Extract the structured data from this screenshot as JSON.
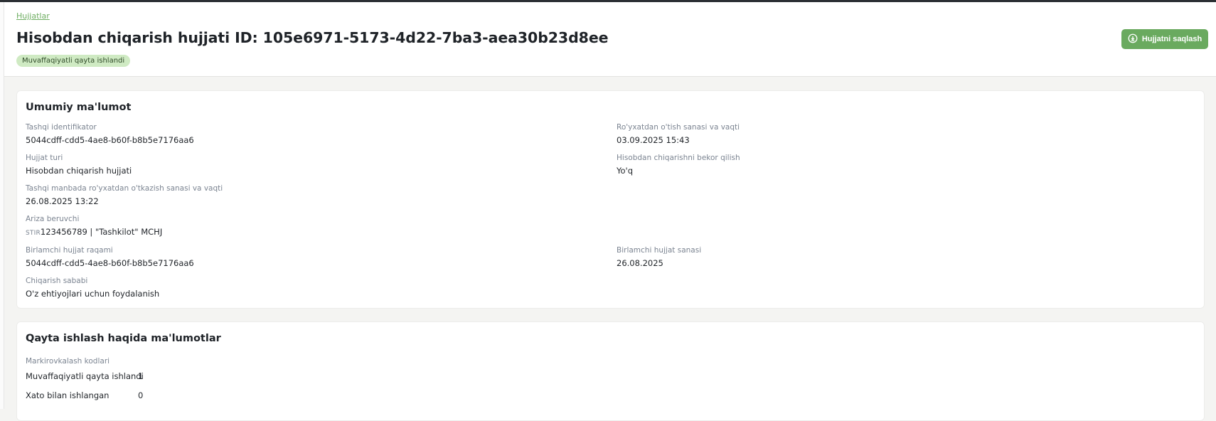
{
  "header": {
    "breadcrumb": "Hujjatlar",
    "title": "Hisobdan chiqarish hujjati ID: 105e6971-5173-4d22-7ba3-aea30b23d8ee",
    "status_badge": "Muvaffaqiyatli qayta ishlandi",
    "save_button": "Hujjatni saqlash",
    "save_icon": "download-icon"
  },
  "general": {
    "title": "Umumiy ma'lumot",
    "external_id": {
      "label": "Tashqi identifikator",
      "value": "5044cdff-cdd5-4ae8-b60f-b8b5e7176aa6"
    },
    "registration_datetime": {
      "label": "Ro'yxatdan o'tish sanasi va vaqti",
      "value": "03.09.2025 15:43"
    },
    "document_type": {
      "label": "Hujjat turi",
      "value": "Hisobdan chiqarish hujjati"
    },
    "cancel_writeoff": {
      "label": "Hisobdan chiqarishni bekor qilish",
      "value": "Yo'q"
    },
    "external_registration": {
      "label": "Tashqi manbada ro'yxatdan o'tkazish sanasi va vaqti",
      "value": "26.08.2025 13:22"
    },
    "applicant": {
      "label": "Ariza beruvchi",
      "prefix": "STIR",
      "value": "123456789 | \"Tashkilot\" MCHJ"
    },
    "primary_doc_number": {
      "label": "Birlamchi hujjat raqami",
      "value": "5044cdff-cdd5-4ae8-b60f-b8b5e7176aa6"
    },
    "primary_doc_date": {
      "label": "Birlamchi hujjat sanasi",
      "value": "26.08.2025"
    },
    "reason": {
      "label": "Chiqarish sababi",
      "value": "O'z ehtiyojlari uchun foydalanish"
    }
  },
  "processing": {
    "title": "Qayta ishlash haqida ma'lumotlar",
    "codes_label": "Markirovkalash kodlari",
    "rows": [
      {
        "label": "Muvaffaqiyatli qayta ishlandi",
        "count": "1"
      },
      {
        "label": "Xato bilan ishlangan",
        "count": "0"
      }
    ]
  },
  "colors": {
    "accent": "#6aaa5f",
    "badge_bg": "#cfeac3",
    "label": "#7b8491"
  }
}
